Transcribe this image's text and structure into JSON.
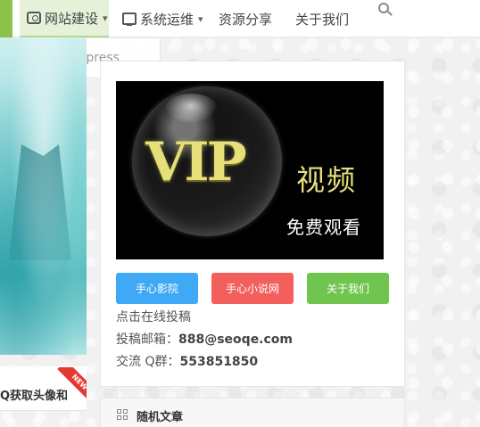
{
  "nav": {
    "items": [
      {
        "label": "网站建设",
        "icon": "camera-icon",
        "has_dropdown": true
      },
      {
        "label": "系统运维",
        "icon": "monitor-icon",
        "has_dropdown": true
      },
      {
        "label": "资源分享"
      },
      {
        "label": "关于我们"
      }
    ],
    "dropdown_item": "wordpress",
    "accent_color": "#8bc34a"
  },
  "left": {
    "caption": "Q获取头像和",
    "badge": "NEW"
  },
  "widget": {
    "image": {
      "logo_text": "VIP",
      "title": "视频",
      "subtitle": "免费观看"
    },
    "buttons": [
      {
        "label": "手心影院",
        "color": "#3fa9f5"
      },
      {
        "label": "手心小说网",
        "color": "#f25f5c"
      },
      {
        "label": "关于我们",
        "color": "#6fc54e"
      }
    ],
    "submit_text": "点击在线投稿",
    "email_label": "投稿邮箱：",
    "email_value": "888@seoqe.com",
    "qq_label": "交流 Q群：",
    "qq_value": "553851850"
  },
  "widget2": {
    "title": "随机文章"
  }
}
